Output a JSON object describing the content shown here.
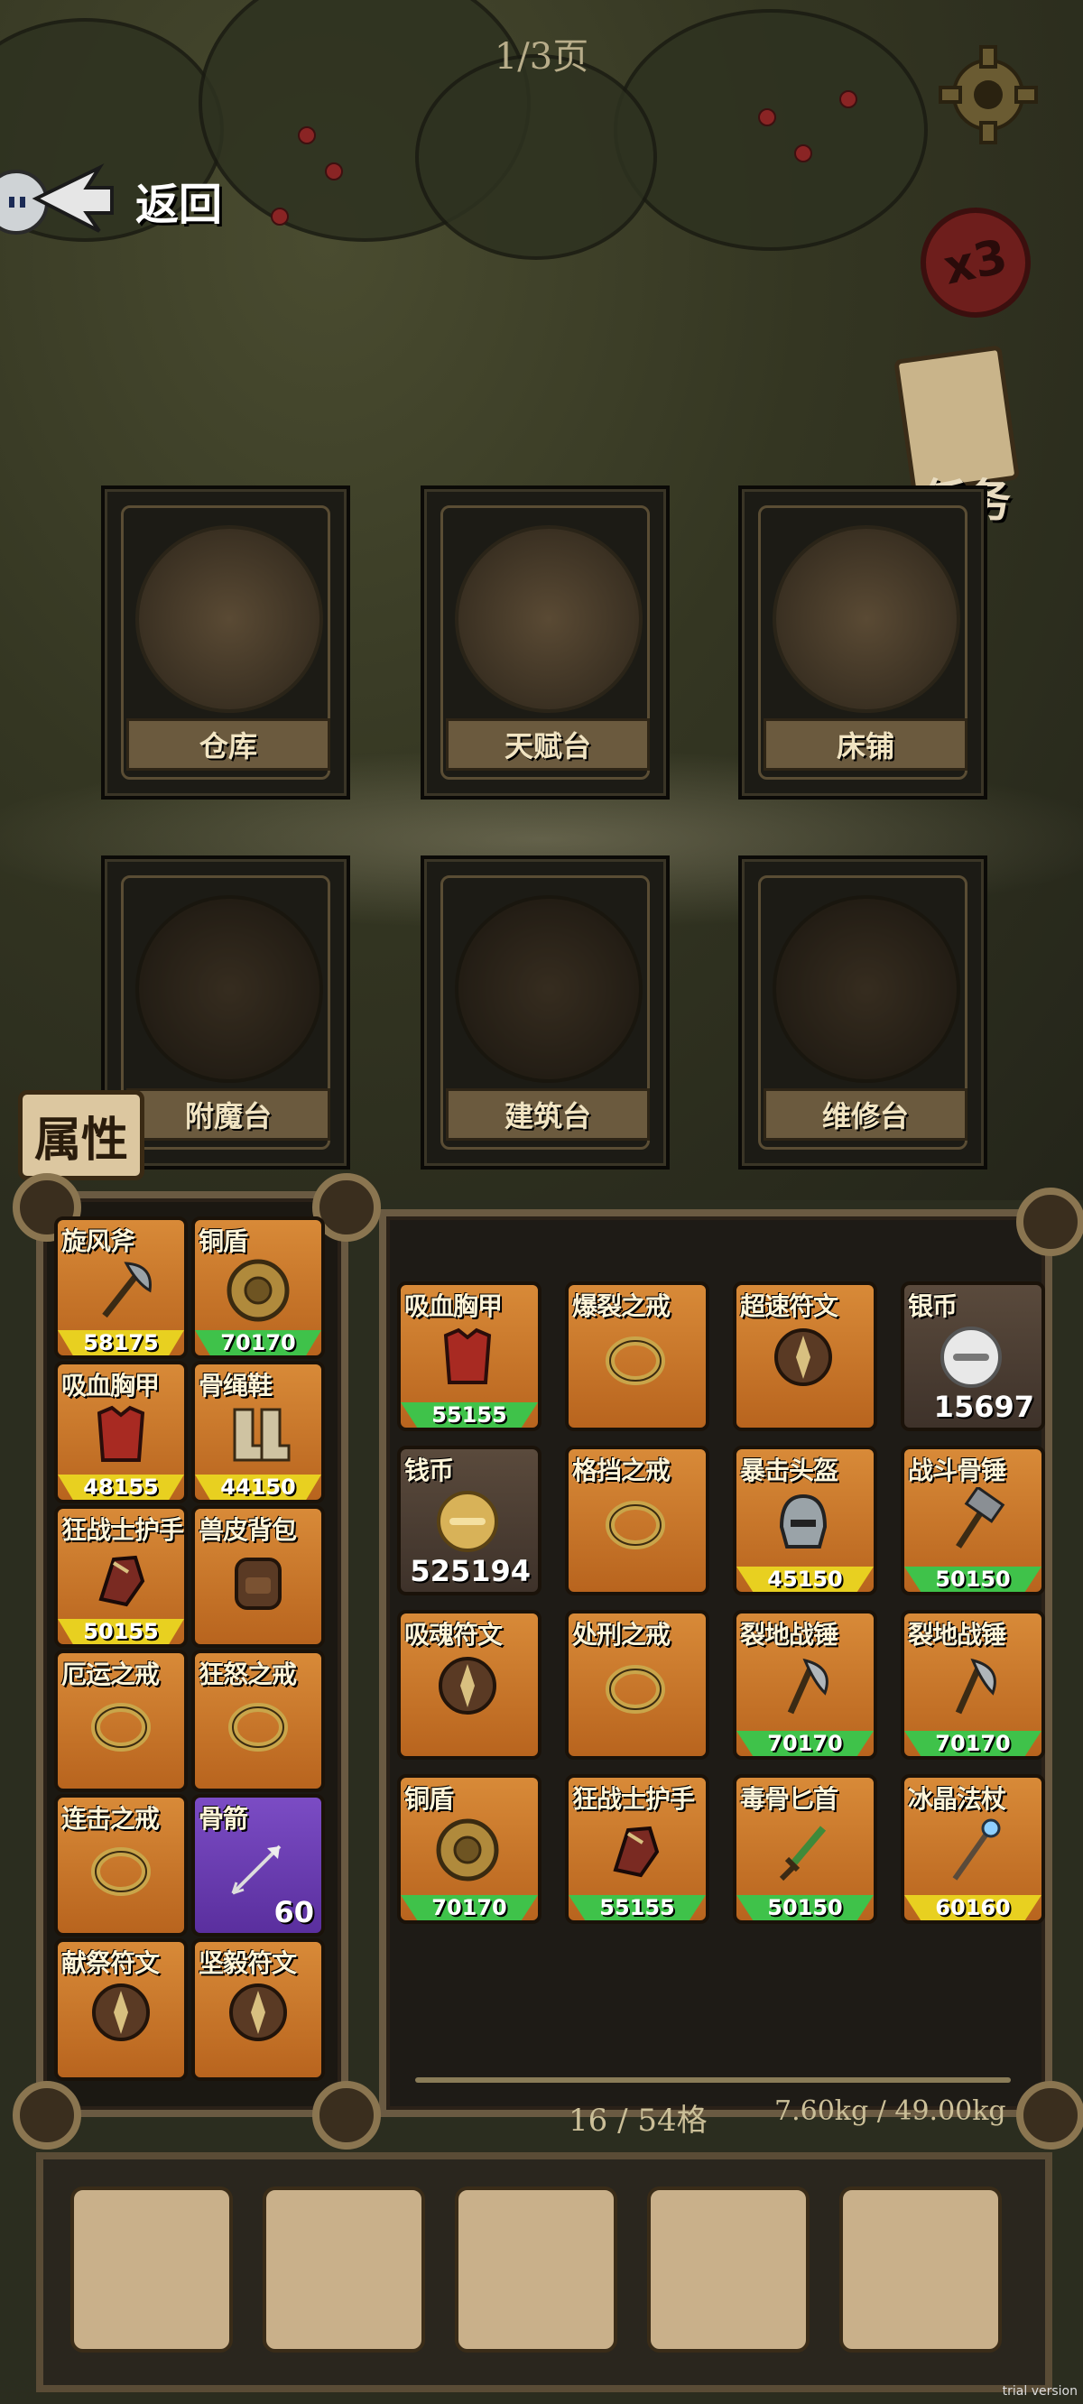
{
  "page_indicator": "1/3页",
  "back": {
    "label": "返回"
  },
  "speed_multiplier": "x3",
  "quest": {
    "label": "任务"
  },
  "facilities": [
    {
      "label": "仓库",
      "icon": "tent-icon"
    },
    {
      "label": "天赋台",
      "icon": "altar-icon"
    },
    {
      "label": "床铺",
      "icon": "bed-icon"
    },
    {
      "label": "附魔台",
      "icon": "enchant-table-icon"
    },
    {
      "label": "建筑台",
      "icon": "building-table-icon"
    },
    {
      "label": "维修台",
      "icon": "repair-table-icon"
    }
  ],
  "attributes_tab": {
    "label": "属性"
  },
  "equipped": [
    {
      "name": "旋风斧",
      "icon": "axe-icon",
      "durability": "58175",
      "bar": "yellow"
    },
    {
      "name": "铜盾",
      "icon": "shield-icon",
      "durability": "70170",
      "bar": "green"
    },
    {
      "name": "吸血胸甲",
      "icon": "chest-armor-icon",
      "durability": "48155",
      "bar": "yellow"
    },
    {
      "name": "骨绳鞋",
      "icon": "boots-icon",
      "durability": "44150",
      "bar": "yellow"
    },
    {
      "name": "狂战士护手",
      "icon": "gauntlet-icon",
      "durability": "50155",
      "bar": "yellow"
    },
    {
      "name": "兽皮背包",
      "icon": "backpack-icon",
      "durability": "",
      "bar": ""
    },
    {
      "name": "厄运之戒",
      "icon": "ring-icon",
      "durability": "",
      "bar": ""
    },
    {
      "name": "狂怒之戒",
      "icon": "ring-icon",
      "durability": "",
      "bar": ""
    },
    {
      "name": "连击之戒",
      "icon": "ring-icon",
      "durability": "",
      "bar": ""
    },
    {
      "name": "骨箭",
      "icon": "arrow-icon",
      "count": "60",
      "rarity": "purple"
    },
    {
      "name": "献祭符文",
      "icon": "rune-icon",
      "durability": "",
      "bar": ""
    },
    {
      "name": "坚毅符文",
      "icon": "rune-icon",
      "durability": "",
      "bar": ""
    }
  ],
  "bag": [
    {
      "name": "吸血胸甲",
      "icon": "chest-armor-icon",
      "durability": "55155",
      "bar": "green"
    },
    {
      "name": "爆裂之戒",
      "icon": "ring-icon",
      "durability": "",
      "bar": ""
    },
    {
      "name": "超速符文",
      "icon": "rune-icon",
      "durability": "",
      "bar": ""
    },
    {
      "name": "银币",
      "icon": "silver-coin-icon",
      "count": "15697",
      "rarity": "grey"
    },
    {
      "name": "钱币",
      "icon": "coin-icon",
      "count": "525194",
      "rarity": "grey"
    },
    {
      "name": "格挡之戒",
      "icon": "ring-icon",
      "durability": "",
      "bar": ""
    },
    {
      "name": "暴击头盔",
      "icon": "helmet-icon",
      "durability": "45150",
      "bar": "yellow"
    },
    {
      "name": "战斗骨锤",
      "icon": "hammer-icon",
      "durability": "50150",
      "bar": "green"
    },
    {
      "name": "吸魂符文",
      "icon": "rune-icon",
      "durability": "",
      "bar": ""
    },
    {
      "name": "处刑之戒",
      "icon": "ring-icon",
      "durability": "",
      "bar": ""
    },
    {
      "name": "裂地战锤",
      "icon": "war-axe-icon",
      "durability": "70170",
      "bar": "green"
    },
    {
      "name": "裂地战锤",
      "icon": "war-axe-icon",
      "durability": "70170",
      "bar": "green"
    },
    {
      "name": "铜盾",
      "icon": "shield-icon",
      "durability": "70170",
      "bar": "green"
    },
    {
      "name": "狂战士护手",
      "icon": "gauntlet-icon",
      "durability": "55155",
      "bar": "green"
    },
    {
      "name": "毒骨匕首",
      "icon": "dagger-icon",
      "durability": "50150",
      "bar": "green"
    },
    {
      "name": "冰晶法杖",
      "icon": "staff-icon",
      "durability": "60160",
      "bar": "yellow"
    }
  ],
  "capacity": "16 / 54格",
  "weight": "7.60kg / 49.00kg",
  "watermark": "trial version",
  "colors": {
    "slot_orange": "#d88a38",
    "slot_purple": "#7b4cc4",
    "bar_green": "#3fc24a",
    "bar_yellow": "#e8d020"
  }
}
